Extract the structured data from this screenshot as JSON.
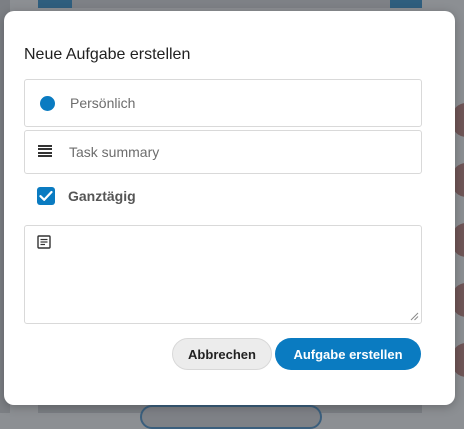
{
  "dialog": {
    "title": "Neue Aufgabe erstellen",
    "calendar": {
      "label": "Persönlich",
      "color": "#0a7bc1"
    },
    "summary": {
      "value": "",
      "placeholder": "Task summary"
    },
    "all_day": {
      "label": "Ganztägig",
      "checked": true
    },
    "description": {
      "value": ""
    },
    "buttons": {
      "cancel_label": "Abbrechen",
      "create_label": "Aufgabe erstellen"
    }
  },
  "colors": {
    "accent": "#0a7bc1"
  }
}
